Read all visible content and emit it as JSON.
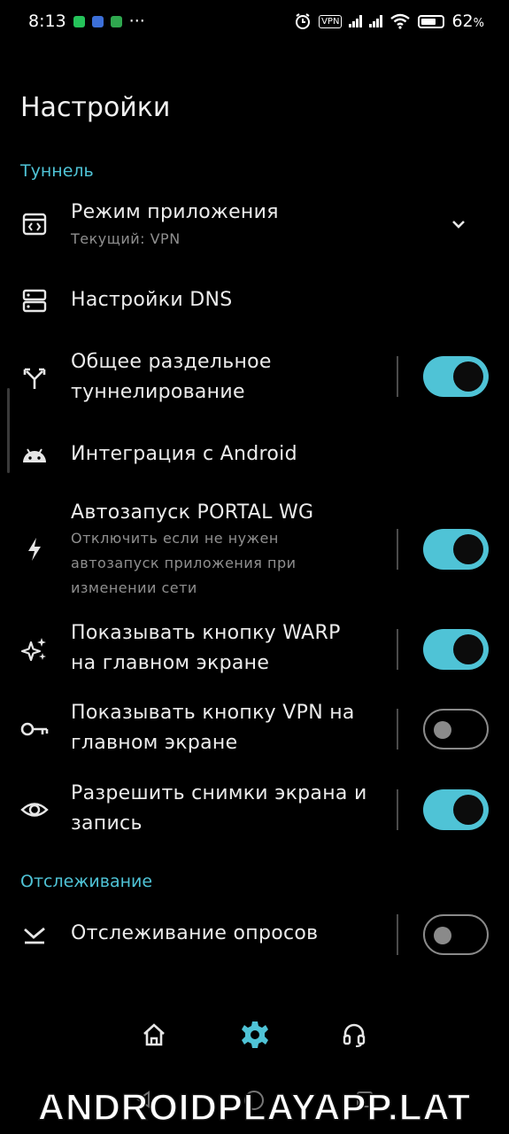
{
  "status_bar": {
    "time": "8:13",
    "vpn": "VPN",
    "battery": "62",
    "battery_unit": "%",
    "more": "···"
  },
  "page": {
    "title": "Настройки"
  },
  "sections": {
    "tunnel": "Туннель",
    "tracking": "Отслеживание"
  },
  "settings": [
    {
      "icon": "app-mode-icon",
      "title": "Режим приложения",
      "subtitle": "Текущий: VPN",
      "control": "chevron"
    },
    {
      "icon": "dns-icon",
      "title": "Настройки DNS",
      "control": "none"
    },
    {
      "icon": "split-tunnel-icon",
      "title_lines": [
        "Общее раздельное",
        "туннелирование"
      ],
      "control": "toggle",
      "enabled": true
    },
    {
      "icon": "android-icon",
      "title": "Интеграция с Android",
      "control": "none"
    },
    {
      "icon": "bolt-icon",
      "title": "Автозапуск PORTAL WG",
      "subtitle_lines": [
        "Отключить если не нужен",
        "автозапуск приложения при",
        "изменении сети"
      ],
      "control": "toggle",
      "enabled": true
    },
    {
      "icon": "sparkles-icon",
      "title_lines": [
        "Показывать кнопку WARP",
        "на главном экране"
      ],
      "control": "toggle",
      "enabled": true
    },
    {
      "icon": "key-icon",
      "title_lines": [
        "Показывать кнопку VPN на",
        "главном экране"
      ],
      "control": "toggle",
      "enabled": false
    },
    {
      "icon": "eye-icon",
      "title_lines": [
        "Разрешить снимки экрана и",
        "запись"
      ],
      "control": "toggle",
      "enabled": true
    },
    {
      "icon": "poll-tracking-icon",
      "title": "Отслеживание опросов",
      "control": "toggle",
      "enabled": false
    }
  ],
  "bottom_nav": [
    {
      "icon": "home-icon",
      "active": false
    },
    {
      "icon": "gear-icon",
      "active": true
    },
    {
      "icon": "headset-icon",
      "active": false
    }
  ],
  "watermark": "ANDROIDPLAYAPP.LAT",
  "colors": {
    "accent": "#4fc3d6",
    "background": "#000000",
    "subtitle": "#8f8f8f"
  }
}
